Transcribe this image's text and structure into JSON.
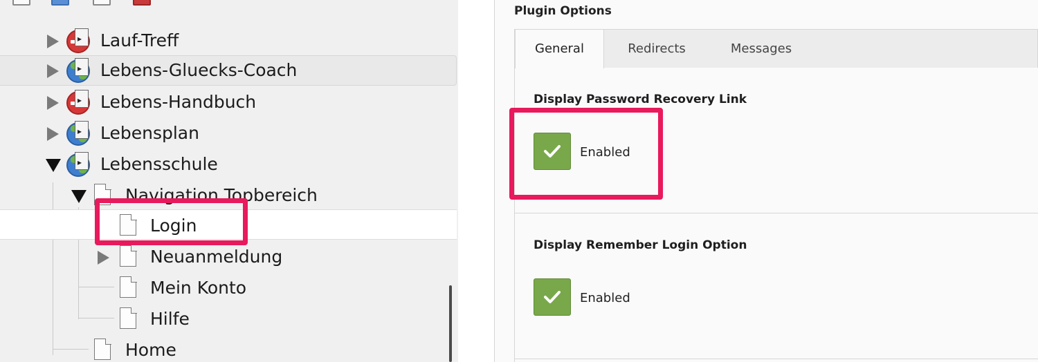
{
  "tree": {
    "items": [
      {
        "label": "Lauf-Treff",
        "type": "site-disabled",
        "toggle": "collapsed"
      },
      {
        "label": "Lebens-Gluecks-Coach",
        "type": "site",
        "toggle": "collapsed"
      },
      {
        "label": "Lebens-Handbuch",
        "type": "site-disabled",
        "toggle": "collapsed"
      },
      {
        "label": "Lebensplan",
        "type": "site",
        "toggle": "collapsed"
      },
      {
        "label": "Lebensschule",
        "type": "site",
        "toggle": "expanded"
      },
      {
        "label": "Navigation Topbereich",
        "type": "page",
        "toggle": "expanded"
      },
      {
        "label": "Login",
        "type": "page",
        "toggle": "none",
        "selected": true
      },
      {
        "label": "Neuanmeldung",
        "type": "page",
        "toggle": "collapsed"
      },
      {
        "label": "Mein Konto",
        "type": "page",
        "toggle": "none"
      },
      {
        "label": "Hilfe",
        "type": "page",
        "toggle": "none"
      },
      {
        "label": "Home",
        "type": "page",
        "toggle": "none"
      }
    ]
  },
  "plugin_options": {
    "title": "Plugin Options",
    "tabs": [
      {
        "label": "General",
        "active": true
      },
      {
        "label": "Redirects",
        "active": false
      },
      {
        "label": "Messages",
        "active": false
      }
    ],
    "fields": [
      {
        "label": "Display Password Recovery Link",
        "checked": true,
        "state_label": "Enabled"
      },
      {
        "label": "Display Remember Login Option",
        "checked": true,
        "state_label": "Enabled"
      }
    ]
  },
  "colors": {
    "highlight": "#e8195c",
    "checkbox": "#79a84a",
    "site_enabled": "#3e7ed0",
    "site_disabled": "#d63838"
  }
}
